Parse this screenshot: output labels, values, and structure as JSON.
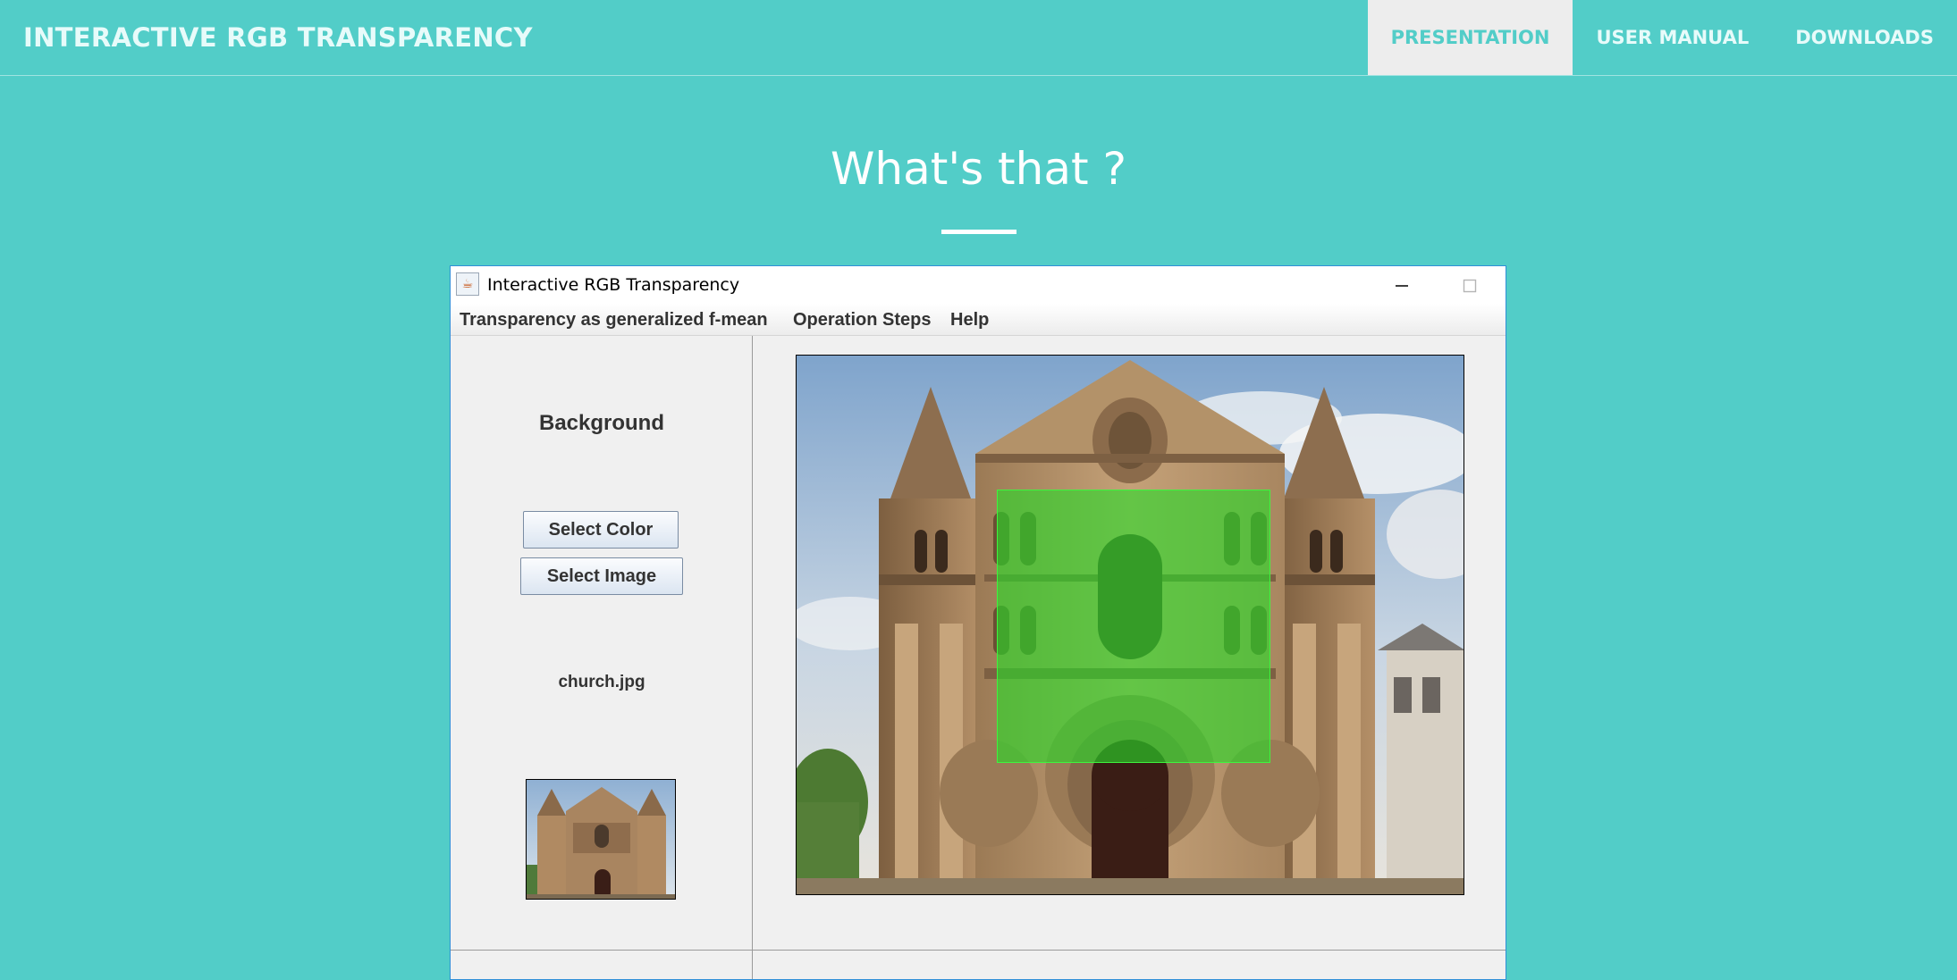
{
  "site": {
    "brand": "INTERACTIVE RGB TRANSPARENCY",
    "nav": [
      {
        "label": "PRESENTATION",
        "active": true
      },
      {
        "label": "USER MANUAL",
        "active": false
      },
      {
        "label": "DOWNLOADS",
        "active": false
      }
    ]
  },
  "hero": {
    "title": "What's that ?"
  },
  "window": {
    "title": "Interactive RGB Transparency",
    "controls": [
      "minimize-icon",
      "maximize-icon",
      "close-icon"
    ],
    "menu": [
      "Transparency as generalized f-mean",
      "Operation Steps",
      "Help"
    ]
  },
  "left_panel": {
    "heading": "Background",
    "select_color_label": "Select Color",
    "select_image_label": "Select Image",
    "file_name": "church.jpg"
  },
  "canvas": {
    "overlay_color": "#28dc28"
  },
  "colors": {
    "page_background": "#52cdc8",
    "nav_active_bg": "#ededed",
    "window_border": "#2f8fd8"
  }
}
